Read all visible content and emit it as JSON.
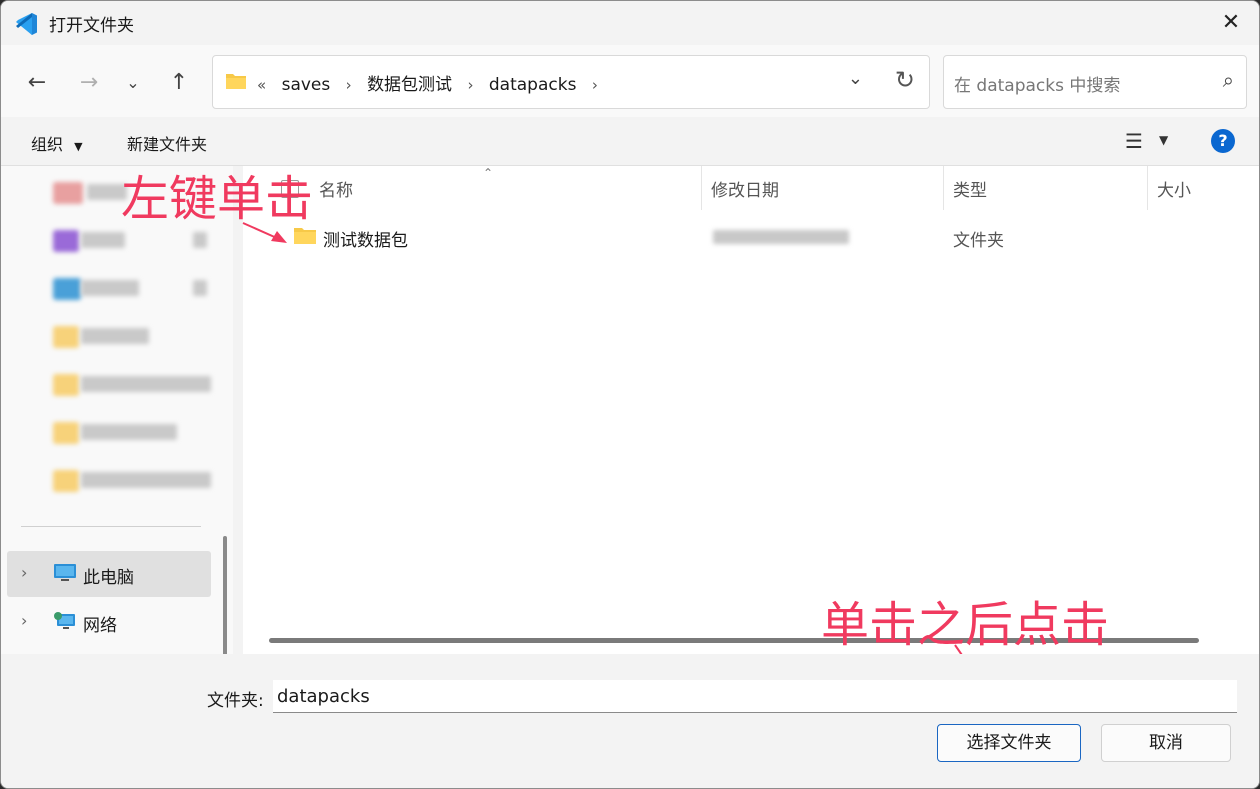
{
  "window": {
    "title": "打开文件夹"
  },
  "toolbar": {
    "breadcrumbs": [
      "saves",
      "数据包测试",
      "datapacks"
    ],
    "breadcrumb_overflow": "«",
    "search_placeholder": "在 datapacks 中搜索"
  },
  "commands": {
    "organize": "组织",
    "new_folder": "新建文件夹"
  },
  "nav_pane": {
    "tree": [
      {
        "label": "此电脑",
        "icon": "monitor-icon",
        "selected": true
      },
      {
        "label": "网络",
        "icon": "network-icon",
        "selected": false
      }
    ]
  },
  "file_list": {
    "columns": [
      "名称",
      "修改日期",
      "类型",
      "大小"
    ],
    "rows": [
      {
        "name": "测试数据包",
        "type": "文件夹",
        "icon": "folder-icon"
      }
    ]
  },
  "annotations": {
    "first": "左键单击",
    "second": "单击之后点击"
  },
  "footer": {
    "folder_label": "文件夹:",
    "folder_value": "datapacks",
    "select_button": "选择文件夹",
    "cancel_button": "取消"
  },
  "colors": {
    "accent": "#0a67d0",
    "annotation": "#f03a5f",
    "folder": "#f7c948"
  }
}
